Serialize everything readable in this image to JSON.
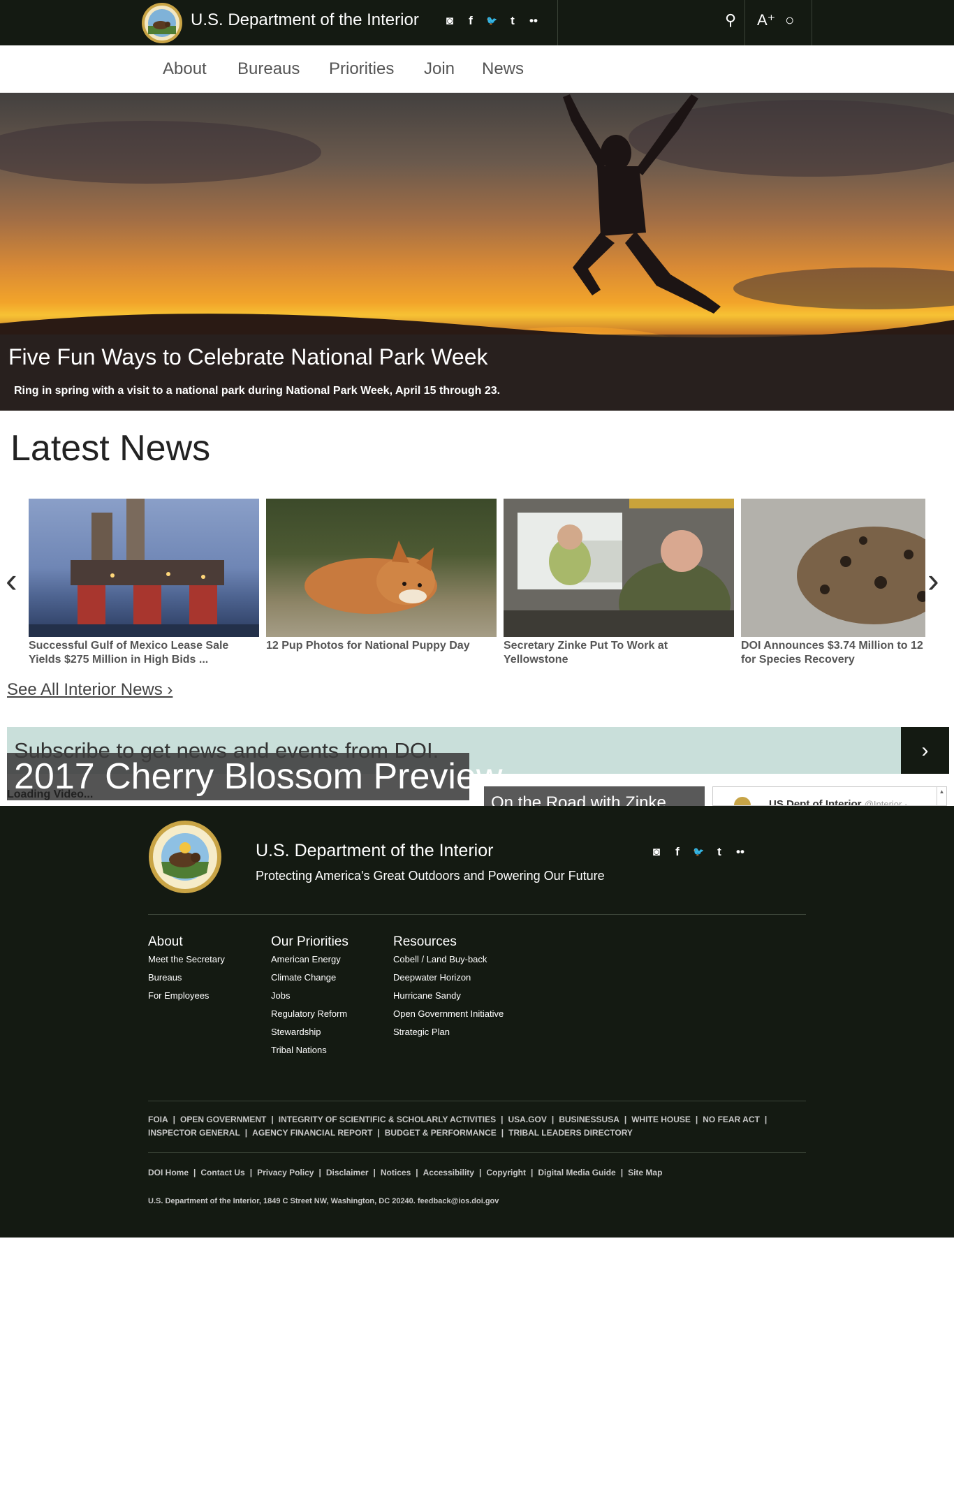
{
  "header": {
    "site_title": "U.S. Department of the Interior",
    "social": [
      {
        "icon": "instagram-icon",
        "glyph": "◙"
      },
      {
        "icon": "facebook-icon",
        "glyph": "f"
      },
      {
        "icon": "twitter-icon",
        "glyph": "🐦"
      },
      {
        "icon": "tumblr-icon",
        "glyph": "t"
      },
      {
        "icon": "flickr-icon",
        "glyph": "••"
      }
    ],
    "tools": {
      "search_glyph": "⚲",
      "text_size_glyph": "A⁺",
      "contrast_glyph": "○"
    }
  },
  "nav": {
    "items": [
      "About",
      "Bureaus",
      "Priorities",
      "Join",
      "News"
    ]
  },
  "hero": {
    "title": "Five Fun Ways to Celebrate National Park Week",
    "subtitle": "Ring in spring with a visit to a national park during National Park Week, April 15 through 23."
  },
  "latest_news": {
    "title": "Latest News",
    "prev_glyph": "‹",
    "next_glyph": "›",
    "cards": [
      {
        "line1": "Successful Gulf of Mexico Lease Sale",
        "line2": "Yields $275 Million in High Bids ..."
      },
      {
        "line1": "12 Pup Photos for National Puppy Day",
        "line2": ""
      },
      {
        "line1": "Secretary Zinke Put To Work at",
        "line2": "Yellowstone"
      },
      {
        "line1": "DOI Announces $3.74 Million to 12",
        "line2": "for Species Recovery"
      }
    ],
    "see_all": "See All Interior News ›"
  },
  "subscribe": {
    "text": "Subscribe to get news and events from DOI.",
    "button_glyph": "›"
  },
  "promo": {
    "title": "2017 Cherry Blossom Preview",
    "loading": "Loading Video...",
    "road": "On the Road with Zinke",
    "tweet_name": "US Dept of Interior",
    "tweet_handle": "@Interior ·"
  },
  "footer": {
    "title": "U.S. Department of the Interior",
    "tagline": "Protecting America's Great Outdoors and Powering Our Future",
    "columns": [
      {
        "heading": "About",
        "links": [
          "Meet the Secretary",
          "Bureaus",
          "For Employees"
        ]
      },
      {
        "heading": "Our Priorities",
        "links": [
          "American Energy",
          "Climate Change",
          "Jobs",
          "Regulatory Reform",
          "Stewardship",
          "Tribal Nations"
        ]
      },
      {
        "heading": "Resources",
        "links": [
          "Cobell / Land Buy-back",
          "Deepwater Horizon",
          "Hurricane Sandy",
          "Open Government Initiative",
          "Strategic Plan"
        ]
      }
    ],
    "links_row1": [
      "FOIA",
      "OPEN GOVERNMENT",
      "INTEGRITY OF SCIENTIFIC & SCHOLARLY ACTIVITIES",
      "USA.GOV",
      "BUSINESSUSA",
      "WHITE HOUSE",
      "NO FEAR ACT",
      ""
    ],
    "links_row2": [
      "INSPECTOR GENERAL",
      "AGENCY FINANCIAL REPORT",
      "BUDGET & PERFORMANCE",
      "TRIBAL LEADERS DIRECTORY"
    ],
    "links_row3": [
      "DOI Home",
      "Contact Us",
      "Privacy Policy",
      "Disclaimer",
      "Notices",
      "Accessibility",
      "Copyright",
      "Digital Media Guide",
      "Site Map"
    ],
    "address": "U.S. Department of the Interior, 1849 C Street NW, Washington, DC 20240. feedback@ios.doi.gov",
    "seal_text": "U.S. DEPARTMENT OF THE INTERIOR",
    "seal_date": "MARCH 3, 1849"
  },
  "colors": {
    "topbar": "#141a12",
    "subscribe_bg": "#c9dfda",
    "footer": "#141a12"
  }
}
